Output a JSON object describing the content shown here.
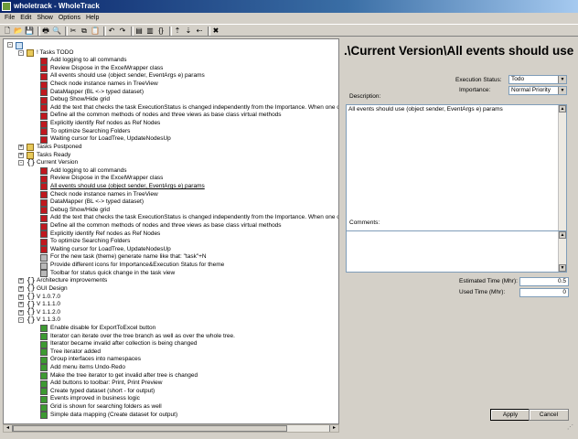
{
  "window": {
    "title": "wholetrack - WholeTrack"
  },
  "menu": [
    "File",
    "Edit",
    "Show",
    "Options",
    "Help"
  ],
  "toolbar": [
    {
      "name": "new-icon",
      "glyph": "🗋"
    },
    {
      "name": "open-icon",
      "glyph": "📂"
    },
    {
      "name": "save-icon",
      "glyph": "💾"
    },
    {
      "name": "sep"
    },
    {
      "name": "print-icon",
      "glyph": "🖶"
    },
    {
      "name": "print-preview-icon",
      "glyph": "🔍"
    },
    {
      "name": "sep"
    },
    {
      "name": "cut-icon",
      "glyph": "✂"
    },
    {
      "name": "copy-icon",
      "glyph": "⧉"
    },
    {
      "name": "paste-icon",
      "glyph": "📋"
    },
    {
      "name": "sep"
    },
    {
      "name": "undo-icon",
      "glyph": "↶"
    },
    {
      "name": "redo-icon",
      "glyph": "↷"
    },
    {
      "name": "sep"
    },
    {
      "name": "add-item-icon",
      "glyph": "▤"
    },
    {
      "name": "add-folder-icon",
      "glyph": "▥"
    },
    {
      "name": "add-version-icon",
      "glyph": "{}"
    },
    {
      "name": "sep"
    },
    {
      "name": "move-up-icon",
      "glyph": "⇡"
    },
    {
      "name": "move-down-icon",
      "glyph": "⇣"
    },
    {
      "name": "move-left-icon",
      "glyph": "⇠"
    },
    {
      "name": "sep"
    },
    {
      "name": "delete-icon",
      "glyph": "✖"
    }
  ],
  "tree": [
    {
      "level": 0,
      "exp": "-",
      "icon": "root",
      "text": ""
    },
    {
      "level": 1,
      "exp": "-",
      "icon": "folder",
      "text": "! Tasks TODO"
    },
    {
      "level": 2,
      "icon": "red",
      "text": "Add logging to all commands"
    },
    {
      "level": 2,
      "icon": "red",
      "text": "Review Dispose in the ExcelWrapper class"
    },
    {
      "level": 2,
      "icon": "red",
      "text": "All events should use (object sender, EventArgs e) params"
    },
    {
      "level": 2,
      "icon": "red",
      "text": "Check node instance names in TreeView"
    },
    {
      "level": 2,
      "icon": "red",
      "text": "DataMapper (BL <-> typed dataset)"
    },
    {
      "level": 2,
      "icon": "red",
      "text": "Debug Show/Hide grid"
    },
    {
      "level": 2,
      "icon": "red",
      "text": "Add the text that checks the task ExecutionStatus is changed independently from the Importance. When one of values is not se"
    },
    {
      "level": 2,
      "icon": "red",
      "text": "Define all the common methods of nodes and three views as base class virtual methods"
    },
    {
      "level": 2,
      "icon": "red",
      "text": "Explicitly identify Ref nodes as Ref Nodes"
    },
    {
      "level": 2,
      "icon": "red",
      "text": "To optimize Searching Folders"
    },
    {
      "level": 2,
      "icon": "red",
      "text": "Waiting cursor for LoadTree, UpdateNodesUp"
    },
    {
      "level": 1,
      "exp": "+",
      "icon": "folder",
      "text": "Tasks Postponed"
    },
    {
      "level": 1,
      "exp": "+",
      "icon": "folder",
      "text": "Tasks Ready"
    },
    {
      "level": 1,
      "exp": "-",
      "icon": "br",
      "text": "Current Version"
    },
    {
      "level": 2,
      "icon": "red",
      "text": "Add logging to all commands"
    },
    {
      "level": 2,
      "icon": "red",
      "text": "Review Dispose in the ExcelWrapper class"
    },
    {
      "level": 2,
      "icon": "red",
      "text": "All events should use (object sender, EventArgs e) params",
      "selected": true
    },
    {
      "level": 2,
      "icon": "red",
      "text": "Check node instance names in TreeView"
    },
    {
      "level": 2,
      "icon": "red",
      "text": "DataMapper (BL <-> typed dataset)"
    },
    {
      "level": 2,
      "icon": "red",
      "text": "Debug Show/Hide grid"
    },
    {
      "level": 2,
      "icon": "red",
      "text": "Add the text that checks the task ExecutionStatus is changed independently from the Importance. When one of values is not se"
    },
    {
      "level": 2,
      "icon": "red",
      "text": "Define all the common methods of nodes and three views as base class virtual methods"
    },
    {
      "level": 2,
      "icon": "red",
      "text": "Explicitly identify Ref nodes as Ref Nodes"
    },
    {
      "level": 2,
      "icon": "red",
      "text": "To optimize Searching Folders"
    },
    {
      "level": 2,
      "icon": "red",
      "text": "Waiting cursor for LoadTree, UpdateNodesUp"
    },
    {
      "level": 2,
      "icon": "grey",
      "text": "For the new task (theme) generate name like that: \"task\"+N"
    },
    {
      "level": 2,
      "icon": "grey",
      "text": "Provide different icons for Importance&Execution Status for theme"
    },
    {
      "level": 2,
      "icon": "grey",
      "text": "Toolbar for status quick change in the task view"
    },
    {
      "level": 1,
      "exp": "+",
      "icon": "br",
      "text": "Architecture improvements"
    },
    {
      "level": 1,
      "exp": "+",
      "icon": "br",
      "text": "GUI Design"
    },
    {
      "level": 1,
      "exp": "+",
      "icon": "br",
      "text": "V 1.0.7.0"
    },
    {
      "level": 1,
      "exp": "+",
      "icon": "br",
      "text": "V 1.1.1.0"
    },
    {
      "level": 1,
      "exp": "+",
      "icon": "br",
      "text": "V 1.1.2.0"
    },
    {
      "level": 1,
      "exp": "-",
      "icon": "br",
      "text": "V 1.1.3.0"
    },
    {
      "level": 2,
      "icon": "green",
      "text": "Enable disable for ExportToExcel button"
    },
    {
      "level": 2,
      "icon": "green",
      "text": "Iterator can iterate over the tree branch as well as over the whole tree."
    },
    {
      "level": 2,
      "icon": "green",
      "text": "Iterator became invalid after collection is being changed"
    },
    {
      "level": 2,
      "icon": "green",
      "text": "Tree iterator added"
    },
    {
      "level": 2,
      "icon": "green",
      "text": "Group interfaces into namespaces"
    },
    {
      "level": 2,
      "icon": "green",
      "text": "Add menu items Undo-Redo"
    },
    {
      "level": 2,
      "icon": "green",
      "text": "Make the tree iterator to get invalid after tree is changed"
    },
    {
      "level": 2,
      "icon": "green",
      "text": "Add buttons to toolbar: Print, Print Preview"
    },
    {
      "level": 2,
      "icon": "green",
      "text": "Create typed dataset (short - for output)"
    },
    {
      "level": 2,
      "icon": "green",
      "text": "Events improved in business logic"
    },
    {
      "level": 2,
      "icon": "green",
      "text": "Grid is shown for searching folders as well"
    },
    {
      "level": 2,
      "icon": "green",
      "text": "Simple data mapping (Create dataset for output)"
    }
  ],
  "detail": {
    "title": ".\\Current Version\\All events should use  (obj...",
    "execution_status_label": "Execution Status:",
    "execution_status_value": "Todo",
    "importance_label": "Importance:",
    "importance_value": "Normal Priority",
    "description_label": "Description:",
    "description_value": "All events should use (object sender, EventArgs e) params",
    "comments_label": "Comments:",
    "comments_value": "",
    "estimated_label": "Estimated Time (Mhr):",
    "estimated_value": "0.5",
    "used_label": "Used Time (Mhr):",
    "used_value": "0",
    "apply_label": "Apply",
    "cancel_label": "Cancel"
  },
  "colors": {
    "selected_underline": "#000000",
    "accent": "#0a246a"
  }
}
